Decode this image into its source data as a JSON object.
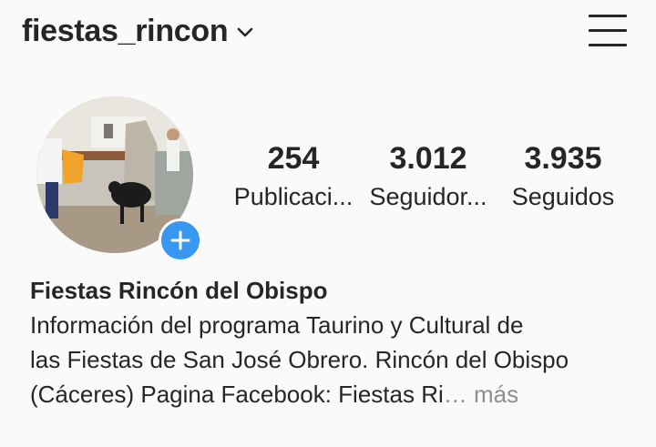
{
  "header": {
    "username": "fiestas_rincon",
    "switch_account_icon": "chevron-down-icon",
    "menu_icon": "hamburger-menu-icon"
  },
  "profile": {
    "avatar_icon": "profile-photo",
    "add_story_icon": "plus-icon",
    "stats": [
      {
        "value": "254",
        "label": "Publicaci..."
      },
      {
        "value": "3.012",
        "label": "Seguidor..."
      },
      {
        "value": "3.935",
        "label": "Seguidos"
      }
    ]
  },
  "bio": {
    "name": "Fiestas Rincón del Obispo",
    "lines": [
      "Información del programa Taurino y Cultural de",
      "las Fiestas de San José Obrero. Rincón del Obispo",
      "(Cáceres)  Pagina Facebook: Fiestas Ri"
    ],
    "more": "… más"
  },
  "colors": {
    "accent": "#3897f0",
    "text": "#262626",
    "muted": "#8e8e8e",
    "background": "#fafafa"
  }
}
